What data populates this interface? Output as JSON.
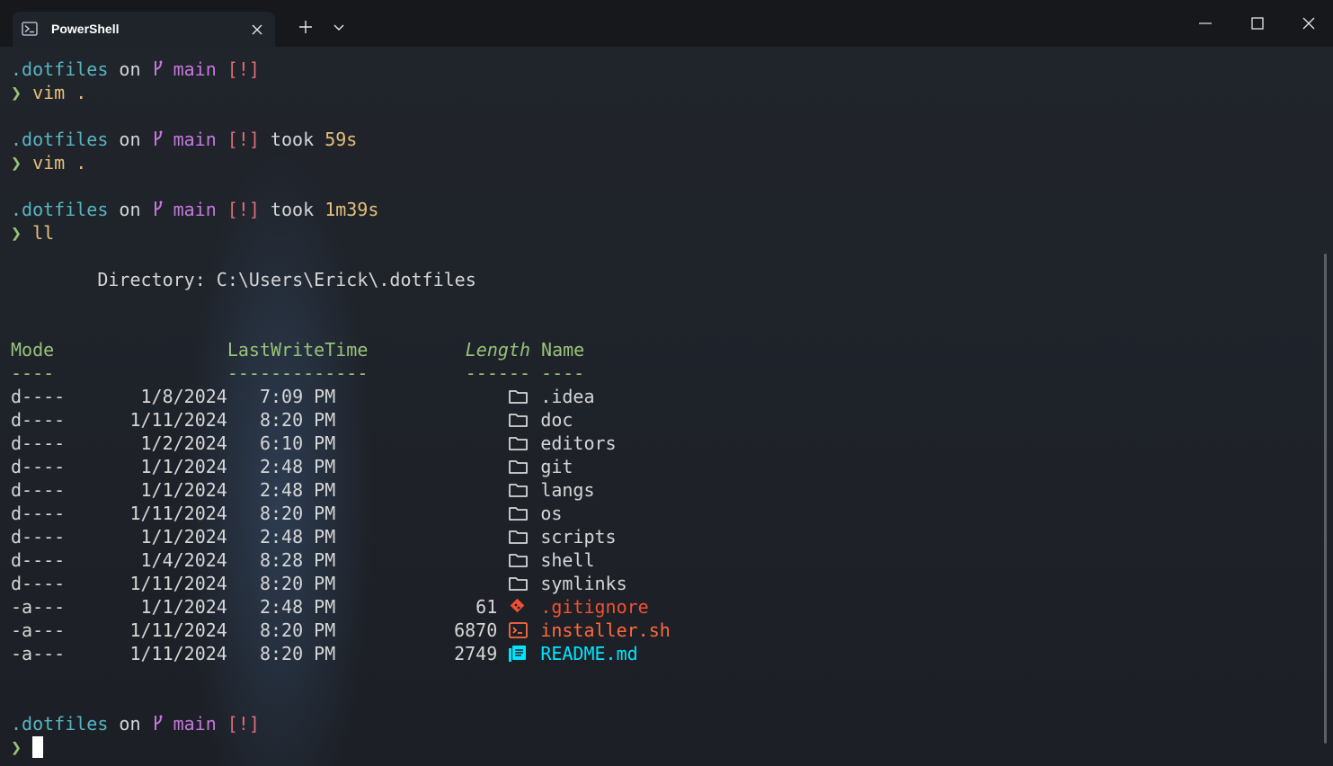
{
  "window": {
    "tab_title": "PowerShell",
    "colors": {
      "dir": "#56b6c2",
      "branch": "#c678dd",
      "status": "#e06c75",
      "duration": "#e5c07b",
      "arrow": "#98c379",
      "header": "#98c379",
      "gitignore": "#f05033",
      "shell_script": "#ff6a3d",
      "markdown": "#00e5ff"
    }
  },
  "prompts": [
    {
      "dir": ".dotfiles",
      "on": " on ",
      "branch": " main",
      "status": " [!]",
      "took": "",
      "duration": "",
      "arrow": "❯",
      "command": " vim ."
    },
    {
      "dir": ".dotfiles",
      "on": " on ",
      "branch": " main",
      "status": " [!]",
      "took": " took ",
      "duration": "59s",
      "arrow": "❯",
      "command": " vim ."
    },
    {
      "dir": ".dotfiles",
      "on": " on ",
      "branch": " main",
      "status": " [!]",
      "took": " took ",
      "duration": "1m39s",
      "arrow": "❯",
      "command": " ll"
    },
    {
      "dir": ".dotfiles",
      "on": " on ",
      "branch": " main",
      "status": " [!]",
      "arrow": "❯"
    }
  ],
  "listing": {
    "directory": "        Directory: C:\\Users\\Erick\\.dotfiles",
    "headers": {
      "mode": "Mode",
      "lastwritetime": "                LastWriteTime",
      "length": "         Length",
      "name": " Name"
    },
    "underline": {
      "mode": "----",
      "lastwritetime": "                -------------",
      "length": "         ------",
      "name": " ----"
    },
    "rows": [
      {
        "mode": "d----",
        "date": "       1/8/2024",
        "time": "   7:09 PM",
        "length": "",
        "icon": "folder-icon",
        "name": ".idea",
        "kind": "dir"
      },
      {
        "mode": "d----",
        "date": "      1/11/2024",
        "time": "   8:20 PM",
        "length": "",
        "icon": "folder-icon",
        "name": "doc",
        "kind": "dir"
      },
      {
        "mode": "d----",
        "date": "       1/2/2024",
        "time": "   6:10 PM",
        "length": "",
        "icon": "folder-icon",
        "name": "editors",
        "kind": "dir"
      },
      {
        "mode": "d----",
        "date": "       1/1/2024",
        "time": "   2:48 PM",
        "length": "",
        "icon": "folder-icon",
        "name": "git",
        "kind": "dir"
      },
      {
        "mode": "d----",
        "date": "       1/1/2024",
        "time": "   2:48 PM",
        "length": "",
        "icon": "folder-icon",
        "name": "langs",
        "kind": "dir"
      },
      {
        "mode": "d----",
        "date": "      1/11/2024",
        "time": "   8:20 PM",
        "length": "",
        "icon": "folder-icon",
        "name": "os",
        "kind": "dir"
      },
      {
        "mode": "d----",
        "date": "       1/1/2024",
        "time": "   2:48 PM",
        "length": "",
        "icon": "folder-icon",
        "name": "scripts",
        "kind": "dir"
      },
      {
        "mode": "d----",
        "date": "       1/4/2024",
        "time": "   8:28 PM",
        "length": "",
        "icon": "folder-icon",
        "name": "shell",
        "kind": "dir"
      },
      {
        "mode": "d----",
        "date": "      1/11/2024",
        "time": "   8:20 PM",
        "length": "",
        "icon": "folder-icon",
        "name": "symlinks",
        "kind": "dir"
      },
      {
        "mode": "-a---",
        "date": "       1/1/2024",
        "time": "   2:48 PM",
        "length": "61",
        "icon": "git-icon",
        "name": ".gitignore",
        "kind": "git"
      },
      {
        "mode": "-a---",
        "date": "      1/11/2024",
        "time": "   8:20 PM",
        "length": "6870",
        "icon": "terminal-icon",
        "name": "installer.sh",
        "kind": "sh"
      },
      {
        "mode": "-a---",
        "date": "      1/11/2024",
        "time": "   8:20 PM",
        "length": "2749",
        "icon": "markdown-icon",
        "name": "README.md",
        "kind": "md"
      }
    ]
  }
}
